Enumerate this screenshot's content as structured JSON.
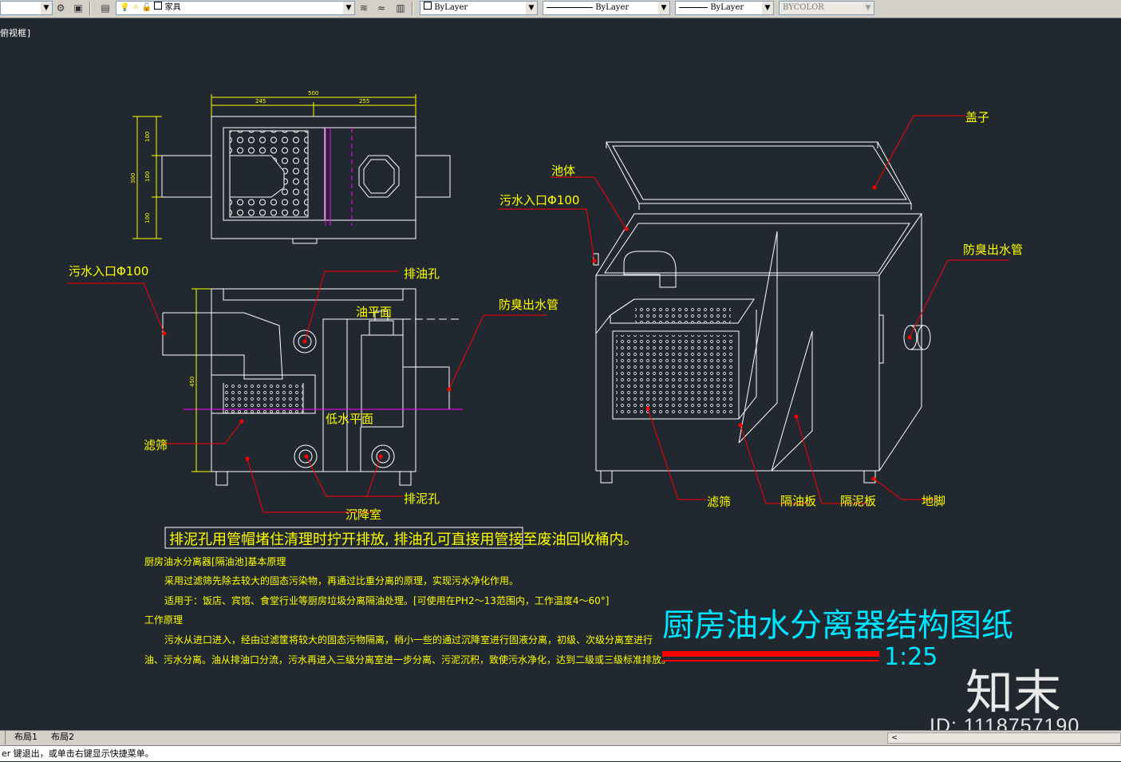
{
  "toolbar": {
    "layer_name": "家具",
    "color": "ByLayer",
    "linetype": "ByLayer",
    "lineweight": "ByLayer",
    "plotstyle": "BYCOLOR"
  },
  "viewport": {
    "label": "俯视框]"
  },
  "plan": {
    "dim_total": "500",
    "dim_left": "245",
    "dim_right": "255",
    "dim_v1": "100",
    "dim_v2": "100",
    "dim_v3": "100",
    "dim_vtotal": "300"
  },
  "section": {
    "dim_height": "450",
    "inlet": "污水入口Φ100",
    "oil_hole": "排油孔",
    "oil_level": "油平面",
    "outlet": "防臭出水管",
    "low_level": "低水平面",
    "filter": "滤筛",
    "settling": "沉降室",
    "sludge_hole": "排泥孔"
  },
  "iso": {
    "lid": "盖子",
    "tank": "池体",
    "inlet": "污水入口Φ100",
    "outlet": "防臭出水管",
    "filter": "滤筛",
    "baffle": "隔油板",
    "sludge_plate": "隔泥板",
    "foot": "地脚"
  },
  "notes": {
    "boxed": "排泥孔用管帽堵住清理时拧开排放, 排油孔可直接用管接至废油回收桶内。",
    "h1": "厨房油水分离器[隔油池]基本原理",
    "p1": "采用过滤筛先除去较大的固态污染物，再通过比重分离的原理，实现污水净化作用。",
    "p2": "适用于：饭店、宾馆、食堂行业等厨房垃圾分离隔油处理。[可使用在PH2～13范围内，工作温度4～60°]",
    "h2": "工作原理",
    "p3": "污水从进口进入，经由过滤筐将较大的固态污物隔离，稍小一些的通过沉降室进行固液分离，初级、次级分离室进行",
    "p4": "油、污水分离。油从排油口分流，污水再进入三级分离室进一步分离、污泥沉积，致使污水净化，达到二级或三级标准排放。"
  },
  "title_block": {
    "title": "厨房油水分离器结构图纸",
    "scale": "1:25"
  },
  "tabs": [
    {
      "label": "布局1"
    },
    {
      "label": "布局2"
    }
  ],
  "command": {
    "text": "er 键退出，或单击右键显示快捷菜单。"
  },
  "watermark": {
    "logo": "知末",
    "id": "ID: 1118757190"
  },
  "colors": {
    "background": "#212830",
    "yellow": "#ffff00",
    "red": "#ff0000",
    "cyan": "#00ffff",
    "magenta": "#ff00ff",
    "white": "#ffffff"
  }
}
